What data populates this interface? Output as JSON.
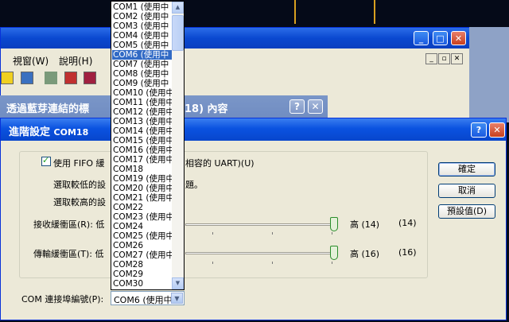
{
  "app_window": {
    "menu": [
      "視窗(W)",
      "說明(H)"
    ]
  },
  "properties_window": {
    "title": "透過藍芽連結的標",
    "title_tail": "18) 內容",
    "help_btn": "?",
    "close_btn": "✕"
  },
  "dialog": {
    "title": "進階設定",
    "title_sub": "COM18",
    "help_btn": "?",
    "close_btn": "✕",
    "fifo_check": {
      "label": "使用 FIFO 緩",
      "label_tail": "相容的 UART)(U)",
      "checked": true
    },
    "hint1": "選取較低的設",
    "hint1_tail": "題。",
    "hint2": "選取較高的設",
    "receive": {
      "label": "接收緩衝區(R): 低",
      "high_label": "高 (14)",
      "value_text": "(14)",
      "level": 14
    },
    "transmit": {
      "label": "傳輸緩衝區(T): 低",
      "high_label": "高 (16)",
      "value_text": "(16)",
      "level": 16
    },
    "com_label": "COM 連接埠編號(P):",
    "com_selected": "COM6 (使用中",
    "buttons": {
      "ok": "確定",
      "cancel": "取消",
      "defaults": "預設值(D)"
    }
  },
  "dropdown": {
    "selected_index": 5,
    "options": [
      "COM1 (使用中",
      "COM2 (使用中",
      "COM3 (使用中",
      "COM4 (使用中",
      "COM5 (使用中",
      "COM6 (使用中",
      "COM7 (使用中",
      "COM8 (使用中",
      "COM9 (使用中",
      "COM10 (使用中",
      "COM11 (使用中",
      "COM12 (使用中",
      "COM13 (使用中",
      "COM14 (使用中",
      "COM15 (使用中",
      "COM16 (使用中",
      "COM17 (使用中",
      "COM18",
      "COM19 (使用中",
      "COM20 (使用中",
      "COM21 (使用中",
      "COM22",
      "COM23 (使用中",
      "COM24",
      "COM25 (使用中",
      "COM26",
      "COM27 (使用中",
      "COM28",
      "COM29",
      "COM30"
    ]
  }
}
